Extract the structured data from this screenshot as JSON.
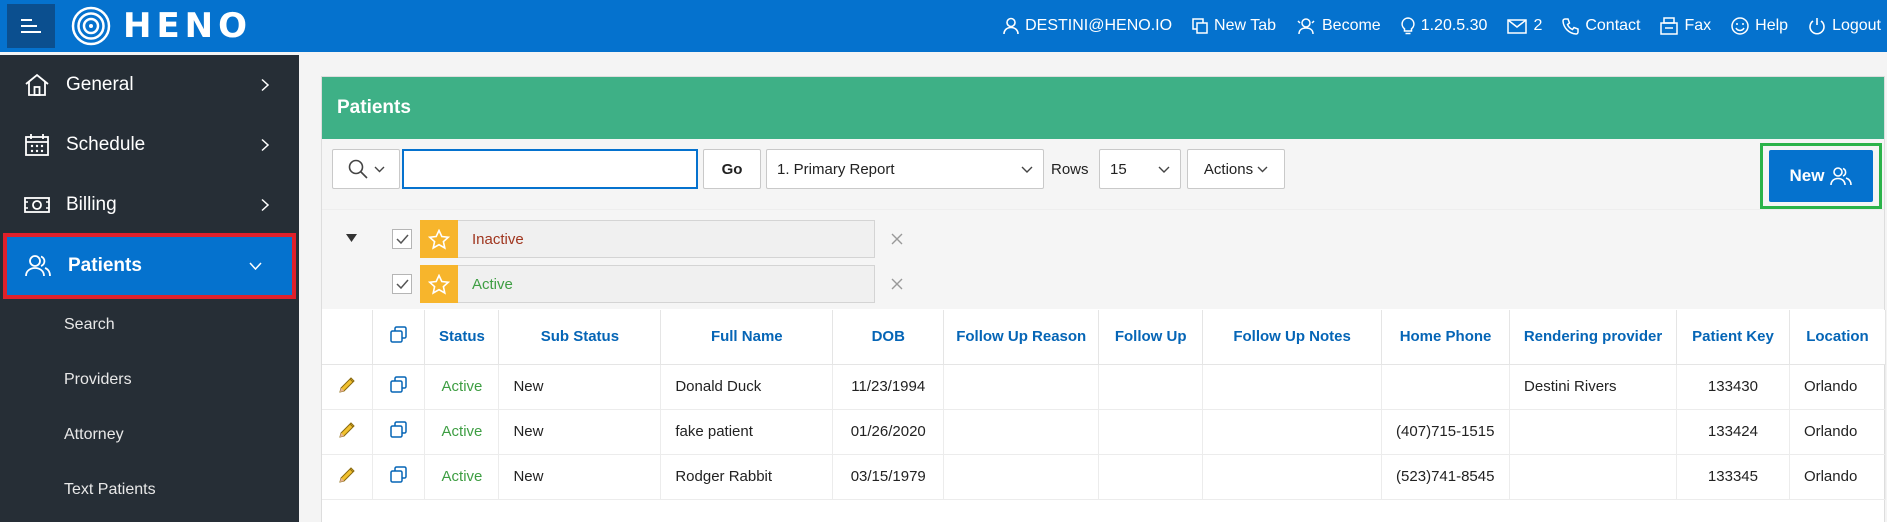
{
  "header": {
    "logo_text": "HENO",
    "user": "DESTINI@HENO.IO",
    "new_tab": "New Tab",
    "become": "Become",
    "version": "1.20.5.30",
    "mail_count": "2",
    "contact": "Contact",
    "fax": "Fax",
    "help": "Help",
    "logout": "Logout"
  },
  "sidebar": {
    "items": [
      {
        "label": "General",
        "icon": "home-icon"
      },
      {
        "label": "Schedule",
        "icon": "calendar-icon"
      },
      {
        "label": "Billing",
        "icon": "money-icon"
      },
      {
        "label": "Patients",
        "icon": "users-icon"
      }
    ],
    "sub_items": [
      "Search",
      "Providers",
      "Attorney",
      "Text Patients"
    ]
  },
  "panel": {
    "title": "Patients",
    "go_label": "Go",
    "search_value": "",
    "report_value": "1. Primary Report",
    "rows_label": "Rows",
    "rows_value": "15",
    "actions_label": "Actions",
    "new_label": "New"
  },
  "filters": [
    {
      "label": "Inactive",
      "color": "#a0361f"
    },
    {
      "label": "Active",
      "color": "#3e9e43"
    }
  ],
  "table": {
    "columns": [
      "Status",
      "Sub Status",
      "Full Name",
      "DOB",
      "Follow Up Reason",
      "Follow Up",
      "Follow Up Notes",
      "Home Phone",
      "Rendering provider",
      "Patient Key",
      "Location"
    ],
    "rows": [
      {
        "status": "Active",
        "sub_status": "New",
        "full_name": "Donald Duck",
        "dob": "11/23/1994",
        "follow_up_reason": "",
        "follow_up": "",
        "follow_up_notes": "",
        "home_phone": "",
        "rendering_provider": "Destini Rivers",
        "patient_key": "133430",
        "location": "Orlando"
      },
      {
        "status": "Active",
        "sub_status": "New",
        "full_name": "fake patient",
        "dob": "01/26/2020",
        "follow_up_reason": "",
        "follow_up": "",
        "follow_up_notes": "",
        "home_phone": "(407)715-1515",
        "rendering_provider": "",
        "patient_key": "133424",
        "location": "Orlando"
      },
      {
        "status": "Active",
        "sub_status": "New",
        "full_name": "Rodger Rabbit",
        "dob": "03/15/1979",
        "follow_up_reason": "",
        "follow_up": "",
        "follow_up_notes": "",
        "home_phone": "(523)741-8545",
        "rendering_provider": "",
        "patient_key": "133345",
        "location": "Orlando"
      }
    ]
  },
  "colors": {
    "header_bg": "#0572ce",
    "sidebar_bg": "#262e36",
    "panel_head": "#3eb086",
    "star": "#f7b52c",
    "highlight_red": "#e0202a",
    "highlight_green": "#2bb34a"
  }
}
